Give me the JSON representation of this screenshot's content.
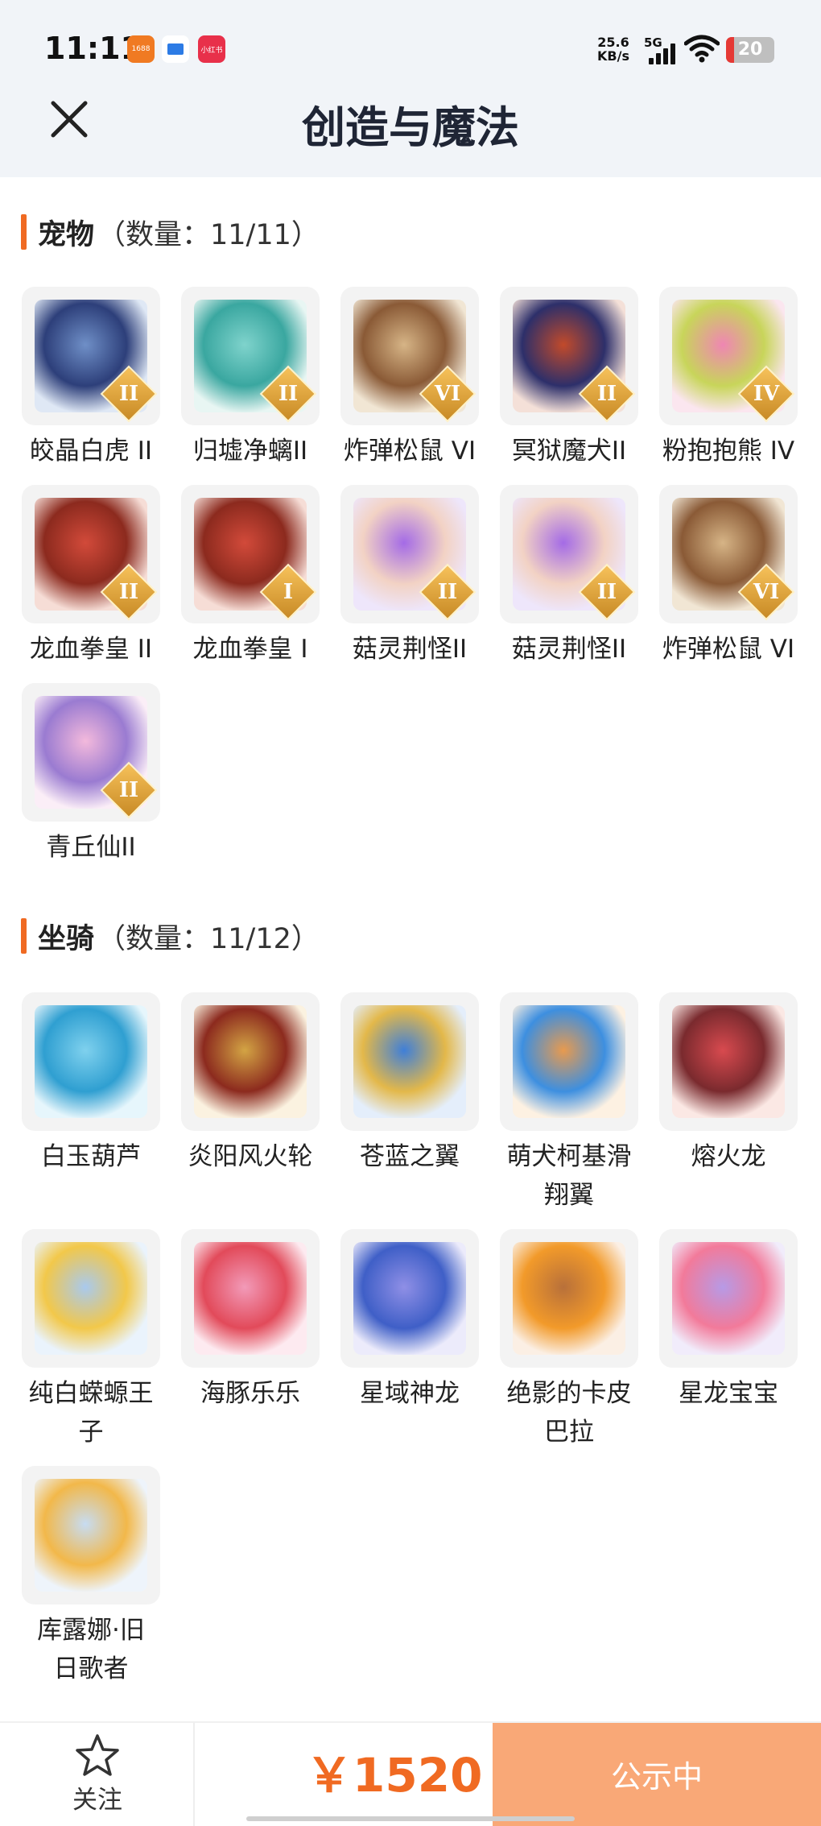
{
  "status_bar": {
    "time": "11:11",
    "net_speed_value": "25.6",
    "net_speed_unit": "KB/s",
    "signal": "5G",
    "battery": "20",
    "app_icons": [
      "1688",
      "app-b",
      "小红书"
    ]
  },
  "header": {
    "title": "创造与魔法",
    "close_icon": "close-icon"
  },
  "pets": {
    "name": "宠物",
    "count": "（数量：11/11）",
    "items": [
      {
        "label": "皎晶白虎 II",
        "badge": "II",
        "colors": [
          "#dfe8f5",
          "#6f8fc7",
          "#2d3f7a"
        ]
      },
      {
        "label": "归墟净螭II",
        "badge": "II",
        "colors": [
          "#e8f6f3",
          "#7fd3cc",
          "#3aa7a0"
        ]
      },
      {
        "label": "炸弹松鼠 VI",
        "badge": "VI",
        "colors": [
          "#f1e6d4",
          "#d6b486",
          "#8a5a36"
        ]
      },
      {
        "label": "冥狱魔犬II",
        "badge": "II",
        "colors": [
          "#f4e0d8",
          "#c24a2a",
          "#2d2f6a"
        ]
      },
      {
        "label": "粉抱抱熊 IV",
        "badge": "IV",
        "colors": [
          "#fbe6ef",
          "#ef86b3",
          "#c8d55a"
        ]
      },
      {
        "label": "龙血拳皇 II",
        "badge": "II",
        "colors": [
          "#f6ddd6",
          "#d24a3a",
          "#8c2a1e"
        ]
      },
      {
        "label": "龙血拳皇 I",
        "badge": "I",
        "colors": [
          "#f6ddd6",
          "#d24a3a",
          "#8c2a1e"
        ]
      },
      {
        "label": "菇灵荆怪II",
        "badge": "II",
        "colors": [
          "#eee6fb",
          "#a46be6",
          "#f2d2c4"
        ]
      },
      {
        "label": "菇灵荆怪II",
        "badge": "II",
        "colors": [
          "#eee6fb",
          "#a46be6",
          "#f2d2c4"
        ]
      },
      {
        "label": "炸弹松鼠 VI",
        "badge": "VI",
        "colors": [
          "#f1e6d4",
          "#d6b486",
          "#8a5a36"
        ]
      },
      {
        "label": "青丘仙II",
        "badge": "II",
        "colors": [
          "#fbeef7",
          "#f3b9dc",
          "#9a7bd1"
        ]
      }
    ]
  },
  "mounts": {
    "name": "坐骑",
    "count": "（数量：11/12）",
    "items": [
      {
        "label": "白玉葫芦",
        "label2": "",
        "colors": [
          "#e6f6fc",
          "#7fd1ee",
          "#2f9fd1"
        ]
      },
      {
        "label": "炎阳风火轮",
        "label2": "",
        "colors": [
          "#fbf2e0",
          "#d3a444",
          "#8c2a1e"
        ]
      },
      {
        "label": "苍蓝之翼",
        "label2": "",
        "colors": [
          "#e4eefb",
          "#3f7fd8",
          "#e3b84a"
        ]
      },
      {
        "label": "萌犬柯基滑",
        "label2": "翔翼",
        "colors": [
          "#fdf1e2",
          "#e89a4e",
          "#3d8fe0"
        ]
      },
      {
        "label": "熔火龙",
        "label2": "",
        "colors": [
          "#fbe8e4",
          "#d84a4f",
          "#7a2a2e"
        ]
      },
      {
        "label": "纯白蝾螈王",
        "label2": "子",
        "colors": [
          "#eaf3fc",
          "#a9c9ee",
          "#f2c84a"
        ]
      },
      {
        "label": "海豚乐乐",
        "label2": "",
        "colors": [
          "#fdeaf0",
          "#f29ab8",
          "#e24a5a"
        ]
      },
      {
        "label": "星域神龙",
        "label2": "",
        "colors": [
          "#ecebfb",
          "#8f8fe6",
          "#3f5fc7"
        ]
      },
      {
        "label": "绝影的卡皮",
        "label2": "巴拉",
        "colors": [
          "#fbefe4",
          "#b8703a",
          "#f29a2a"
        ]
      },
      {
        "label": "星龙宝宝",
        "label2": "",
        "colors": [
          "#f1ecfb",
          "#b79ae6",
          "#f27a9a"
        ]
      },
      {
        "label": "库露娜·旧",
        "label2": "日歌者",
        "colors": [
          "#eef4fb",
          "#c7dcf2",
          "#f2b84a"
        ]
      }
    ]
  },
  "bottom_bar": {
    "follow_label": "关注",
    "price": "￥1520",
    "status_label": "公示中"
  },
  "colors": {
    "accent": "#f06a22",
    "status_button": "#f9a877",
    "header_bg": "#f1f4f8"
  }
}
